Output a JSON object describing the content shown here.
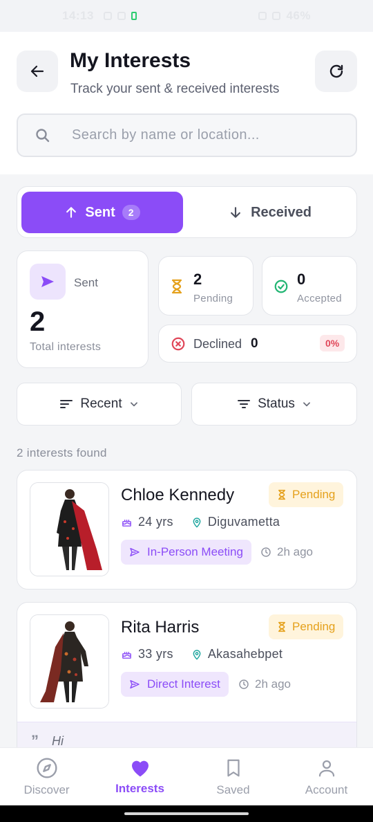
{
  "status_bar": {
    "time": "14:13",
    "battery": "46%"
  },
  "header": {
    "title": "My Interests",
    "subtitle": "Track your sent & received interests",
    "search_placeholder": "Search by name or location..."
  },
  "tabs": [
    {
      "label": "Sent",
      "count": "2",
      "active": true
    },
    {
      "label": "Received",
      "active": false
    }
  ],
  "stats": {
    "sent": {
      "label": "Sent",
      "value": "2",
      "caption": "Total interests"
    },
    "pending": {
      "value": "2",
      "label": "Pending"
    },
    "accepted": {
      "value": "0",
      "label": "Accepted"
    },
    "declined": {
      "label": "Declined",
      "value": "0",
      "percent": "0%"
    }
  },
  "filters": {
    "sort": "Recent",
    "status": "Status"
  },
  "results_text": "2 interests found",
  "interests": [
    {
      "name": "Chloe Kennedy",
      "status": "Pending",
      "age": "24 yrs",
      "location": "Diguvametta",
      "type": "In-Person Meeting",
      "time": "2h ago"
    },
    {
      "name": "Rita Harris",
      "status": "Pending",
      "age": "33 yrs",
      "location": "Akasahebpet",
      "type": "Direct Interest",
      "time": "2h ago",
      "message": "Hi"
    }
  ],
  "bottom_nav": [
    {
      "label": "Discover",
      "icon": "compass-icon"
    },
    {
      "label": "Interests",
      "icon": "heart-icon",
      "active": true
    },
    {
      "label": "Saved",
      "icon": "bookmark-icon"
    },
    {
      "label": "Account",
      "icon": "person-icon"
    }
  ],
  "colors": {
    "accent": "#8b4cf7",
    "pending": "#e5a11c",
    "accepted": "#22b573",
    "declined": "#e04759"
  }
}
